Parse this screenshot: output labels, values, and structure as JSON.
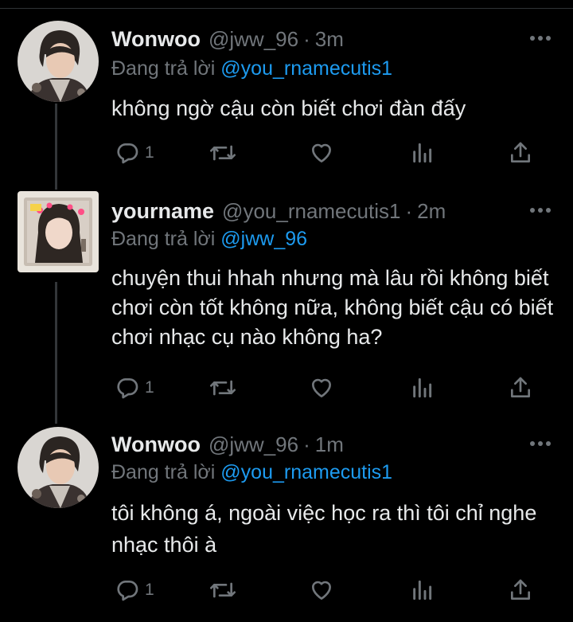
{
  "tweets": [
    {
      "name": "Wonwoo",
      "handle": "@jww_96",
      "time": "3m",
      "reply_prefix": "Đang trả lời",
      "reply_to": "@you_rnamecutis1",
      "text": "không ngờ cậu còn biết chơi đàn đấy",
      "reply_count": "1"
    },
    {
      "name": "yourname",
      "handle": "@you_rnamecutis1",
      "time": "2m",
      "reply_prefix": "Đang trả lời",
      "reply_to": "@jww_96",
      "text": "chuyện thui hhah nhưng mà lâu rồi không biết chơi còn tốt không nữa, không biết cậu có biết chơi nhạc cụ nào không ha?",
      "reply_count": "1"
    },
    {
      "name": "Wonwoo",
      "handle": "@jww_96",
      "time": "1m",
      "reply_prefix": "Đang trả lời",
      "reply_to": "@you_rnamecutis1",
      "text": "tôi không á, ngoài việc học ra thì tôi chỉ nghe nhạc thôi à",
      "reply_count": "1"
    }
  ],
  "separator": "·",
  "icons": {
    "reply": "reply-icon",
    "retweet": "retweet-icon",
    "like": "heart-icon",
    "views": "views-icon",
    "share": "share-icon",
    "more": "more-icon"
  },
  "colors": {
    "background": "#000000",
    "text": "#e7e9ea",
    "muted": "#71767b",
    "link": "#1d9bf0",
    "line": "#333639"
  }
}
